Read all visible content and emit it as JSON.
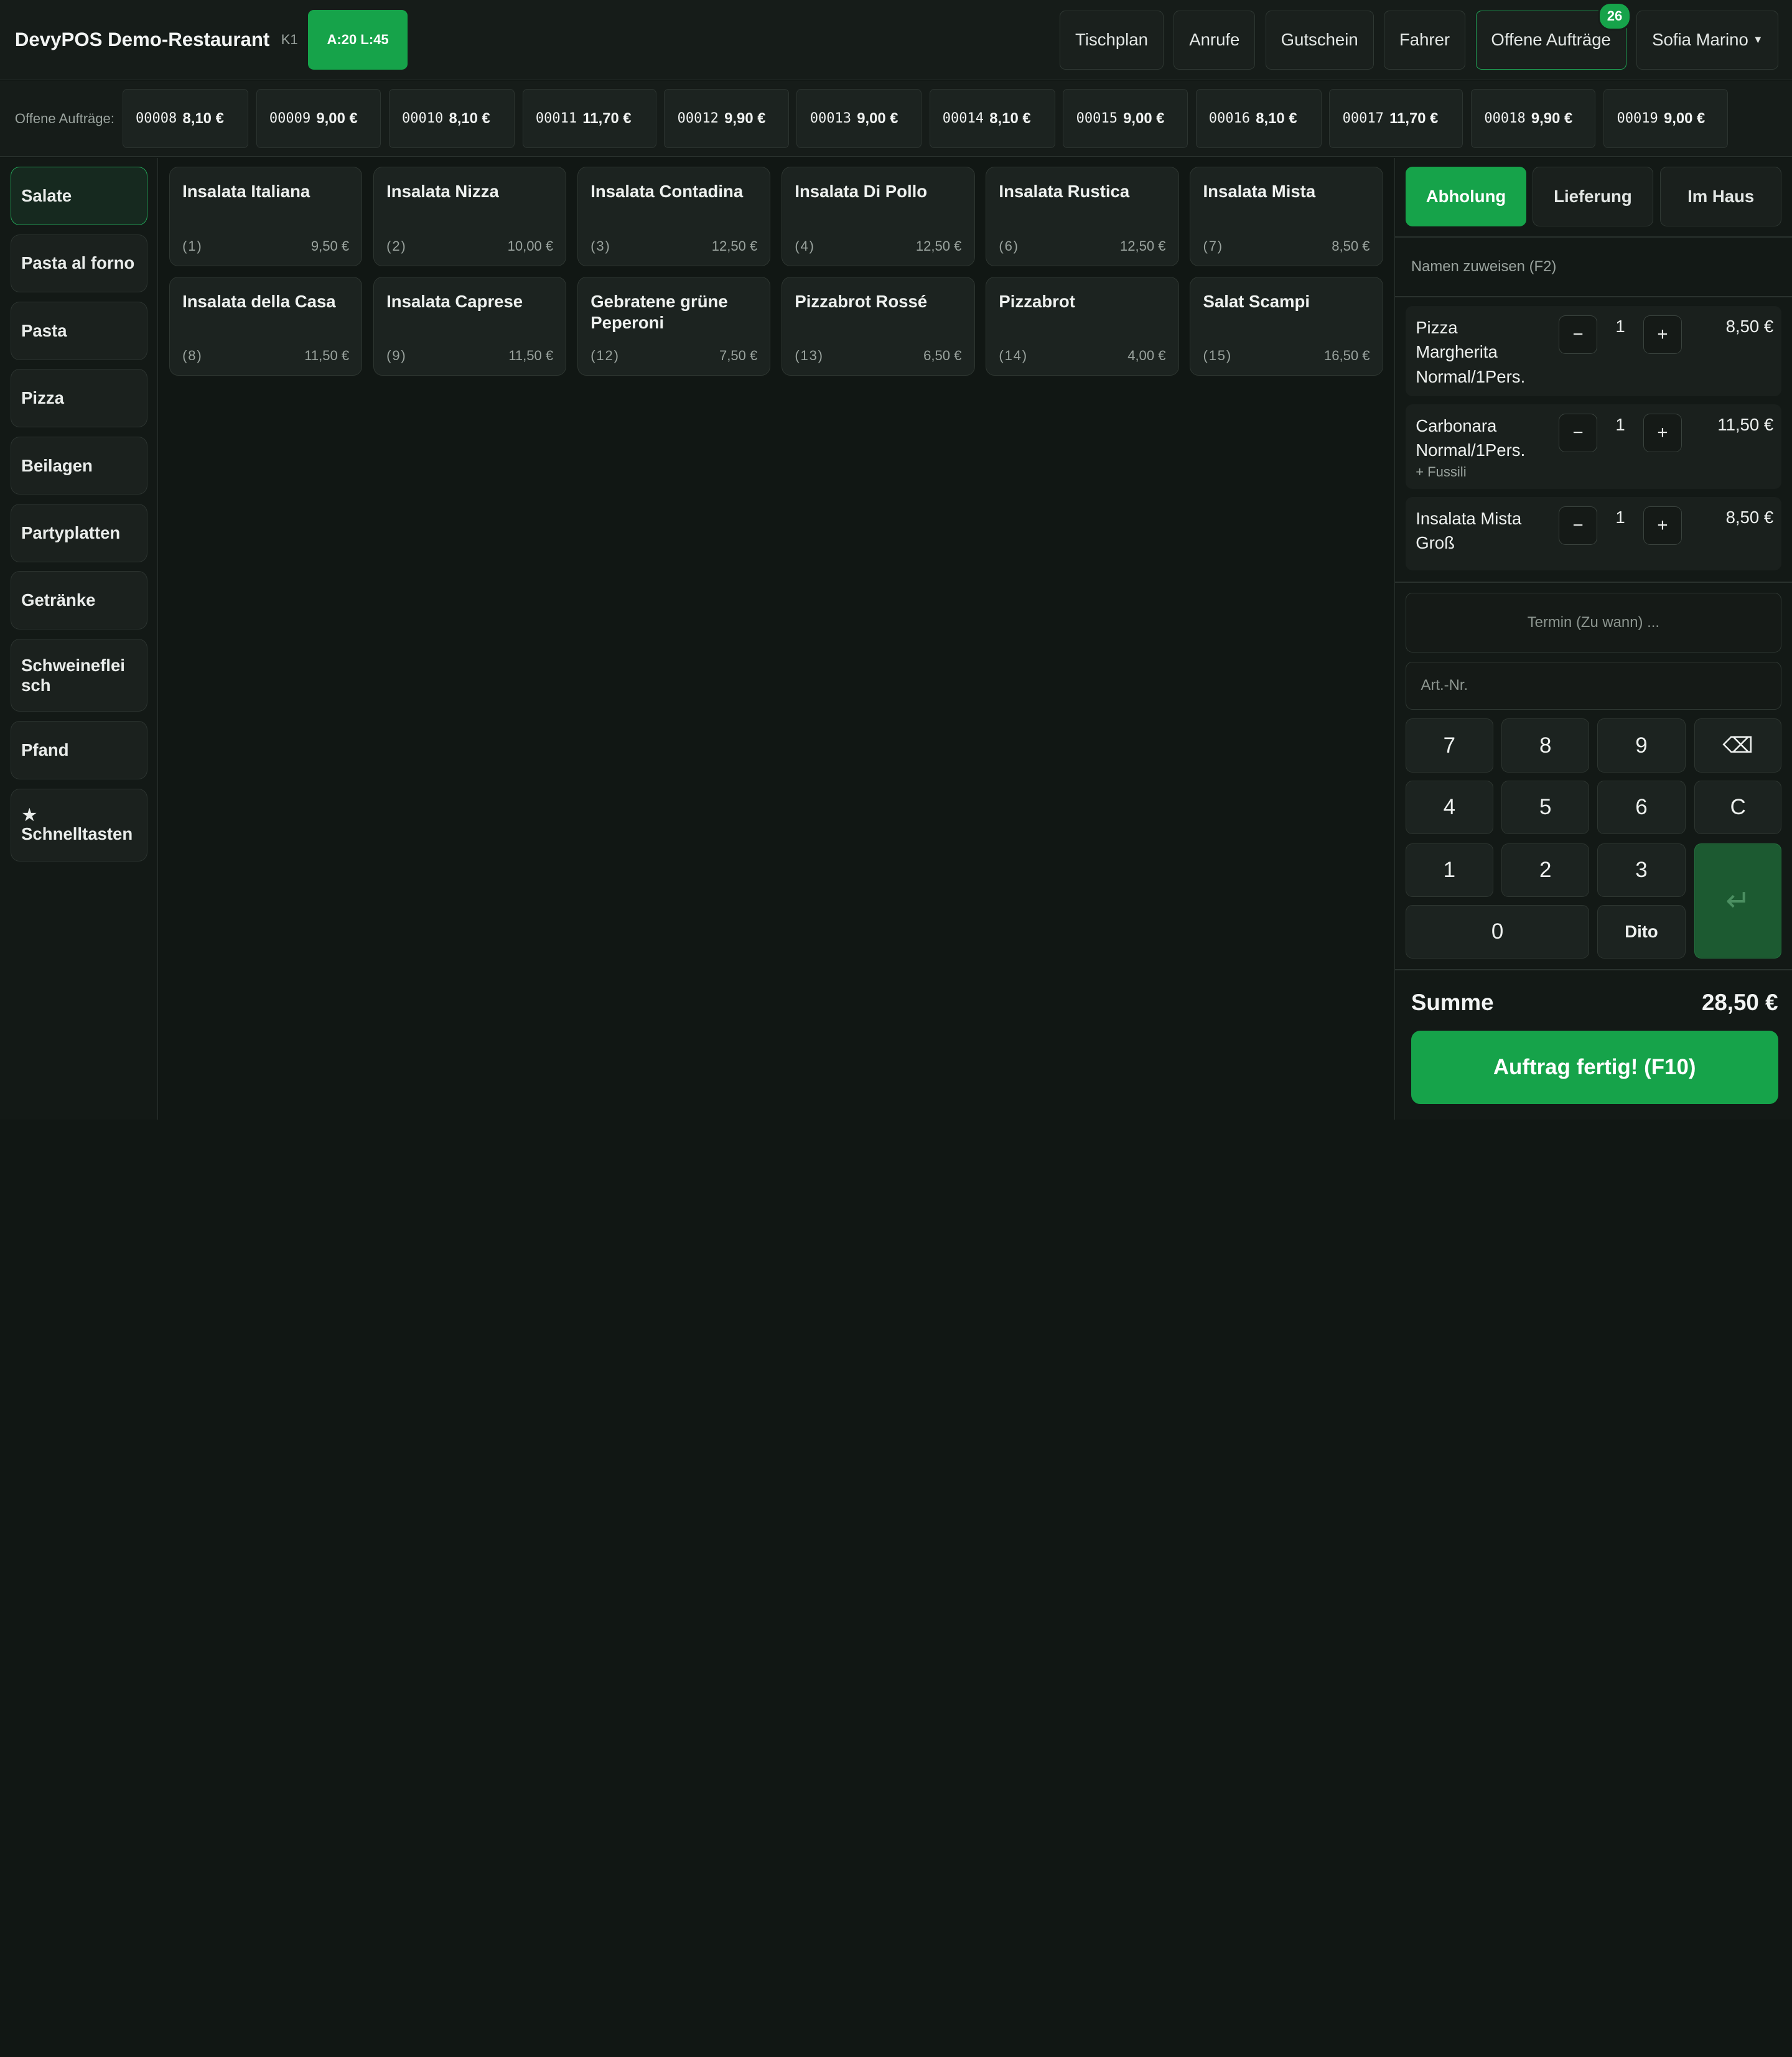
{
  "header": {
    "title": "DevyPOS Demo-Restaurant",
    "terminal": "K1",
    "counts_badge": "A:20 L:45",
    "nav": [
      "Tischplan",
      "Anrufe",
      "Gutschein",
      "Fahrer"
    ],
    "open_orders_label": "Offene Aufträge",
    "open_orders_count": "26",
    "user": "Sofia Marino"
  },
  "orders_bar": {
    "label": "Offene Aufträge:",
    "orders": [
      {
        "id": "00008",
        "amount": "8,10 €"
      },
      {
        "id": "00009",
        "amount": "9,00 €"
      },
      {
        "id": "00010",
        "amount": "8,10 €"
      },
      {
        "id": "00011",
        "amount": "11,70 €"
      },
      {
        "id": "00012",
        "amount": "9,90 €"
      },
      {
        "id": "00013",
        "amount": "9,00 €"
      },
      {
        "id": "00014",
        "amount": "8,10 €"
      },
      {
        "id": "00015",
        "amount": "9,00 €"
      },
      {
        "id": "00016",
        "amount": "8,10 €"
      },
      {
        "id": "00017",
        "amount": "11,70 €"
      },
      {
        "id": "00018",
        "amount": "9,90 €"
      },
      {
        "id": "00019",
        "amount": "9,00 €"
      }
    ]
  },
  "categories": [
    {
      "label": "Salate",
      "active": true
    },
    {
      "label": "Pasta al forno"
    },
    {
      "label": "Pasta"
    },
    {
      "label": "Pizza"
    },
    {
      "label": "Beilagen"
    },
    {
      "label": "Partyplatten"
    },
    {
      "label": "Getränke"
    },
    {
      "label": "Schweineflei sch"
    },
    {
      "label": "Pfand"
    },
    {
      "label": "Schnelltasten",
      "icon": "star-icon"
    }
  ],
  "products": [
    {
      "name": "Insalata Italiana",
      "num": "(1)",
      "price": "9,50 €"
    },
    {
      "name": "Insalata Nizza",
      "num": "(2)",
      "price": "10,00 €"
    },
    {
      "name": "Insalata Contadina",
      "num": "(3)",
      "price": "12,50 €"
    },
    {
      "name": "Insalata Di Pollo",
      "num": "(4)",
      "price": "12,50 €"
    },
    {
      "name": "Insalata Rustica",
      "num": "(6)",
      "price": "12,50 €"
    },
    {
      "name": "Insalata Mista",
      "num": "(7)",
      "price": "8,50 €"
    },
    {
      "name": "Insalata della Casa",
      "num": "(8)",
      "price": "11,50 €"
    },
    {
      "name": "Insalata Caprese",
      "num": "(9)",
      "price": "11,50 €"
    },
    {
      "name": "Gebratene grüne Peperoni",
      "num": "(12)",
      "price": "7,50 €"
    },
    {
      "name": "Pizzabrot Rossé",
      "num": "(13)",
      "price": "6,50 €"
    },
    {
      "name": "Pizzabrot",
      "num": "(14)",
      "price": "4,00 €"
    },
    {
      "name": "Salat Scampi",
      "num": "(15)",
      "price": "16,50 €"
    }
  ],
  "order_types": [
    "Abholung",
    "Lieferung",
    "Im Haus"
  ],
  "assign_name": "Namen zuweisen (F2)",
  "cart": [
    {
      "name": "Pizza Margherita Normal/1Pers.",
      "modifier": "",
      "qty": "1",
      "price": "8,50 €"
    },
    {
      "name": "Carbonara Normal/1Pers.",
      "modifier": "+ Fussili",
      "qty": "1",
      "price": "11,50 €"
    },
    {
      "name": "Insalata Mista Groß",
      "modifier": "",
      "qty": "1",
      "price": "8,50 €"
    }
  ],
  "qty_minus": "−",
  "qty_plus": "+",
  "termin_placeholder": "Termin (Zu wann) ...",
  "artnr_placeholder": "Art.-Nr.",
  "keypad": [
    "7",
    "8",
    "9",
    "4",
    "5",
    "6",
    "C",
    "1",
    "2",
    "3",
    "0",
    "Dito"
  ],
  "backspace_icon": "backspace-icon",
  "enter_icon": "enter-icon",
  "summe_label": "Summe",
  "summe_value": "28,50 €",
  "submit_label": "Auftrag fertig! (F10)",
  "colors": {
    "accent": "#16a34a",
    "background": "#111714",
    "panel": "#1c2320"
  }
}
